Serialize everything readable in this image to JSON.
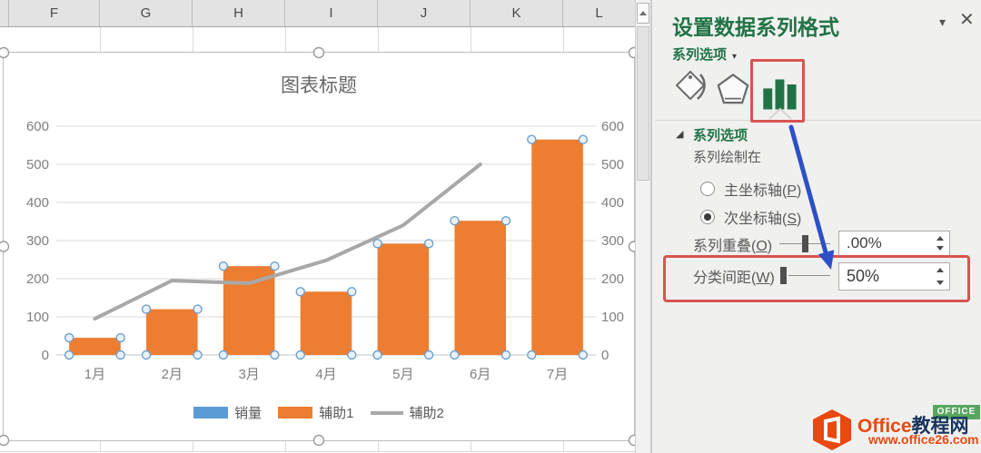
{
  "colors": {
    "panel_green": "#217346",
    "annotation_red": "#d85450",
    "annotation_blue": "#2d50c8"
  },
  "spreadsheet": {
    "column_headers": [
      "F",
      "G",
      "H",
      "I",
      "J",
      "K",
      "L"
    ]
  },
  "chart_data": {
    "type": "combo",
    "title": "图表标题",
    "categories": [
      "1月",
      "2月",
      "3月",
      "4月",
      "5月",
      "6月",
      "7月"
    ],
    "series": [
      {
        "name": "销量",
        "type": "bar",
        "color": "#5B9BD5",
        "values": [
          null,
          null,
          null,
          null,
          null,
          null,
          null
        ]
      },
      {
        "name": "辅助1",
        "type": "bar",
        "color": "#ED7D31",
        "selected": true,
        "values": [
          45,
          120,
          233,
          166,
          292,
          352,
          565
        ]
      },
      {
        "name": "辅助2",
        "type": "line",
        "color": "#A8A8A8",
        "values": [
          95,
          195,
          188,
          248,
          340,
          500,
          null
        ]
      }
    ],
    "ylim": [
      0,
      600
    ],
    "ytick_step": 100,
    "secondary_ylim": [
      0,
      600
    ],
    "grid": true,
    "legend_position": "bottom",
    "gap_width_pct": 50
  },
  "panel": {
    "title": "设置数据系列格式",
    "collapse_icon": "▾",
    "close_icon": "✕",
    "group_label": "系列选项",
    "group_arrow": "▾",
    "section": {
      "expand_icon": "◢",
      "title": "系列选项",
      "plot_on": "系列绘制在",
      "radio_primary": {
        "prefix": "主坐标轴(",
        "key": "P",
        "suffix": ")",
        "selected": false
      },
      "radio_secondary": {
        "prefix": "次坐标轴(",
        "key": "S",
        "suffix": ")",
        "selected": true
      },
      "overlap": {
        "prefix": "系列重叠(",
        "key": "O",
        "suffix": ")",
        "value": ".00%"
      },
      "gap": {
        "prefix": "分类间距(",
        "key": "W",
        "suffix": ")",
        "value": "50%"
      }
    }
  },
  "watermark": {
    "badge": "OFFICE",
    "brand_orange": "Office",
    "brand_dark": "教程网",
    "url": "www.office26.com"
  }
}
